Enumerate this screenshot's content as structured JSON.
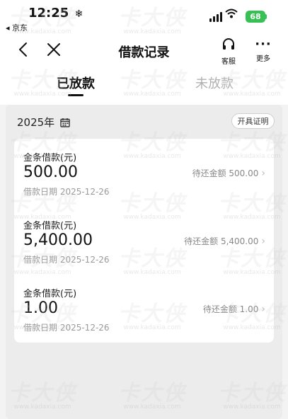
{
  "status_bar": {
    "time": "12:25",
    "time_icon": "❄",
    "back_app": "◂ 京东",
    "battery": "68"
  },
  "nav": {
    "title": "借款记录",
    "service_label": "客服",
    "more_label": "更多"
  },
  "tabs": [
    {
      "label": "已放款",
      "active": true
    },
    {
      "label": "未放款",
      "active": false
    }
  ],
  "section": {
    "year": "2025年",
    "certificate_button": "开具证明"
  },
  "loans": [
    {
      "title": "金条借款(元)",
      "amount": "500.00",
      "due": "待还金额 500.00",
      "date": "借款日期 2025-12-26"
    },
    {
      "title": "金条借款(元)",
      "amount": "5,400.00",
      "due": "待还金额 5,400.00",
      "date": "借款日期 2025-12-26"
    },
    {
      "title": "金条借款(元)",
      "amount": "1.00",
      "due": "待还金额 1.00",
      "date": "借款日期 2025-12-26"
    }
  ],
  "watermark": {
    "text": "卡大侠",
    "url": "www.kadaxia.com"
  },
  "colors": {
    "battery": "#37c154",
    "tab_inactive": "#b0b0b0",
    "background": "#f3f3f3"
  }
}
